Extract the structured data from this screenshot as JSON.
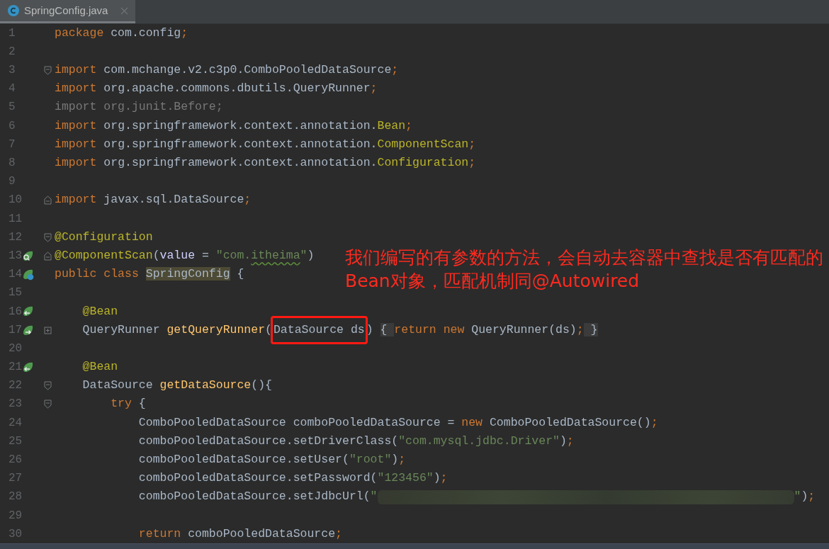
{
  "tab": {
    "title": "SpringConfig.java",
    "selected": true
  },
  "lines": [
    {
      "n": "1",
      "tokens": [
        {
          "kind": "keyword",
          "text": "package"
        },
        {
          "kind": "plain",
          "text": " com.config"
        },
        {
          "kind": "keyword",
          "text": ";"
        }
      ]
    },
    {
      "n": "2"
    },
    {
      "n": "3",
      "fold_marker": {
        "kind": "start"
      },
      "tokens": [
        {
          "kind": "keyword",
          "text": "import"
        },
        {
          "kind": "plain",
          "text": " com.mchange.v2.c3p0.ComboPooledDataSource"
        },
        {
          "kind": "keyword",
          "text": ";"
        }
      ]
    },
    {
      "n": "4",
      "tokens": [
        {
          "kind": "keyword",
          "text": "import"
        },
        {
          "kind": "plain",
          "text": " org.apache.commons.dbutils.QueryRunner"
        },
        {
          "kind": "keyword",
          "text": ";"
        }
      ]
    },
    {
      "n": "5",
      "tokens": [
        {
          "kind": "unused",
          "text": "import org.junit.Before;"
        }
      ]
    },
    {
      "n": "6",
      "tokens": [
        {
          "kind": "keyword",
          "text": "import"
        },
        {
          "kind": "plain",
          "text": " org.springframework.context.annotation."
        },
        {
          "kind": "annotation",
          "text": "Bean"
        },
        {
          "kind": "keyword",
          "text": ";"
        }
      ]
    },
    {
      "n": "7",
      "tokens": [
        {
          "kind": "keyword",
          "text": "import"
        },
        {
          "kind": "plain",
          "text": " org.springframework.context.annotation."
        },
        {
          "kind": "annotation",
          "text": "ComponentScan"
        },
        {
          "kind": "keyword",
          "text": ";"
        }
      ]
    },
    {
      "n": "8",
      "tokens": [
        {
          "kind": "keyword",
          "text": "import"
        },
        {
          "kind": "plain",
          "text": " org.springframework.context.annotation."
        },
        {
          "kind": "annotation",
          "text": "Configuration"
        },
        {
          "kind": "keyword",
          "text": ";"
        }
      ]
    },
    {
      "n": "9"
    },
    {
      "n": "10",
      "fold_marker": {
        "kind": "end"
      },
      "tokens": [
        {
          "kind": "keyword",
          "text": "import"
        },
        {
          "kind": "plain",
          "text": " javax.sql.DataSource"
        },
        {
          "kind": "keyword",
          "text": ";"
        }
      ]
    },
    {
      "n": "11"
    },
    {
      "n": "12",
      "fold_marker": {
        "kind": "start"
      },
      "tokens": [
        {
          "kind": "annotation",
          "text": "@Configuration"
        }
      ]
    },
    {
      "n": "13",
      "fold_marker": {
        "kind": "end"
      },
      "gutter_icon": {
        "kind": "bean-search"
      },
      "tokens": [
        {
          "kind": "annotation",
          "text": "@ComponentScan"
        },
        {
          "kind": "plain",
          "text": "("
        },
        {
          "kind": "param",
          "text": "value"
        },
        {
          "kind": "plain",
          "text": " = "
        },
        {
          "kind": "string",
          "text": "\"com."
        },
        {
          "kind": "typo",
          "text": "itheima"
        },
        {
          "kind": "string",
          "text": "\""
        },
        {
          "kind": "plain",
          "text": ")"
        }
      ]
    },
    {
      "n": "14",
      "gutter_icon": {
        "kind": "bean-class"
      },
      "tokens": [
        {
          "kind": "keyword",
          "text": "public class "
        },
        {
          "kind": "highlight",
          "text": "SpringConfig"
        },
        {
          "kind": "plain",
          "text": " {"
        }
      ]
    },
    {
      "n": "15"
    },
    {
      "n": "16",
      "gutter_icon": {
        "kind": "bean-out"
      },
      "tokens": [
        {
          "kind": "annotation",
          "text": "    @Bean"
        }
      ]
    },
    {
      "n": "17",
      "fold_marker": {
        "kind": "folded"
      },
      "gutter_icon": {
        "kind": "bean-in"
      },
      "tokens": [
        {
          "kind": "plain",
          "text": "    QueryRunner "
        },
        {
          "kind": "method",
          "text": "getQueryRunner"
        },
        {
          "kind": "plain",
          "text": "("
        },
        {
          "kind": "boxed",
          "text": "DataSource ds"
        },
        {
          "kind": "plain",
          "text": ") "
        },
        {
          "kind": "folded",
          "text": "{ "
        },
        {
          "kind": "keyword",
          "text": "return new "
        },
        {
          "kind": "plain",
          "text": "QueryRunner(ds)"
        },
        {
          "kind": "keyword",
          "text": ";"
        },
        {
          "kind": "folded",
          "text": " }"
        }
      ]
    },
    {
      "n": "20"
    },
    {
      "n": "21",
      "gutter_icon": {
        "kind": "bean-out"
      },
      "tokens": [
        {
          "kind": "annotation",
          "text": "    @Bean"
        }
      ]
    },
    {
      "n": "22",
      "fold_marker": {
        "kind": "start"
      },
      "tokens": [
        {
          "kind": "plain",
          "text": "    DataSource "
        },
        {
          "kind": "method",
          "text": "getDataSource"
        },
        {
          "kind": "plain",
          "text": "(){"
        }
      ]
    },
    {
      "n": "23",
      "fold_marker": {
        "kind": "start"
      },
      "tokens": [
        {
          "kind": "keyword",
          "text": "        try"
        },
        {
          "kind": "plain",
          "text": " {"
        }
      ]
    },
    {
      "n": "24",
      "tokens": [
        {
          "kind": "plain",
          "text": "            ComboPooledDataSource comboPooledDataSource = "
        },
        {
          "kind": "keyword",
          "text": "new "
        },
        {
          "kind": "plain",
          "text": "ComboPooledDataSource()"
        },
        {
          "kind": "keyword",
          "text": ";"
        }
      ]
    },
    {
      "n": "25",
      "tokens": [
        {
          "kind": "plain",
          "text": "            comboPooledDataSource.setDriverClass("
        },
        {
          "kind": "string",
          "text": "\"com.mysql.jdbc.Driver\""
        },
        {
          "kind": "plain",
          "text": ")"
        },
        {
          "kind": "keyword",
          "text": ";"
        }
      ]
    },
    {
      "n": "26",
      "tokens": [
        {
          "kind": "plain",
          "text": "            comboPooledDataSource.setUser("
        },
        {
          "kind": "string",
          "text": "\"root\""
        },
        {
          "kind": "plain",
          "text": ")"
        },
        {
          "kind": "keyword",
          "text": ";"
        }
      ]
    },
    {
      "n": "27",
      "tokens": [
        {
          "kind": "plain",
          "text": "            comboPooledDataSource.setPassword("
        },
        {
          "kind": "string",
          "text": "\"123456\""
        },
        {
          "kind": "plain",
          "text": ")"
        },
        {
          "kind": "keyword",
          "text": ";"
        }
      ]
    },
    {
      "n": "28",
      "tokens": [
        {
          "kind": "plain",
          "text": "            comboPooledDataSource.setJdbcUrl("
        },
        {
          "kind": "string",
          "text": "\""
        },
        {
          "kind": "blurred"
        },
        {
          "kind": "string",
          "text": "\""
        },
        {
          "kind": "plain",
          "text": ")"
        },
        {
          "kind": "keyword",
          "text": ";"
        }
      ]
    },
    {
      "n": "29"
    },
    {
      "n": "30",
      "tokens": [
        {
          "kind": "keyword",
          "text": "            return "
        },
        {
          "kind": "plain",
          "text": "comboPooledDataSource"
        },
        {
          "kind": "keyword",
          "text": ";"
        }
      ]
    }
  ],
  "annotation_note": "我们编写的有参数的方法，会自动去容器中查找是否有匹配的Bean对象，匹配机制同@Autowired"
}
